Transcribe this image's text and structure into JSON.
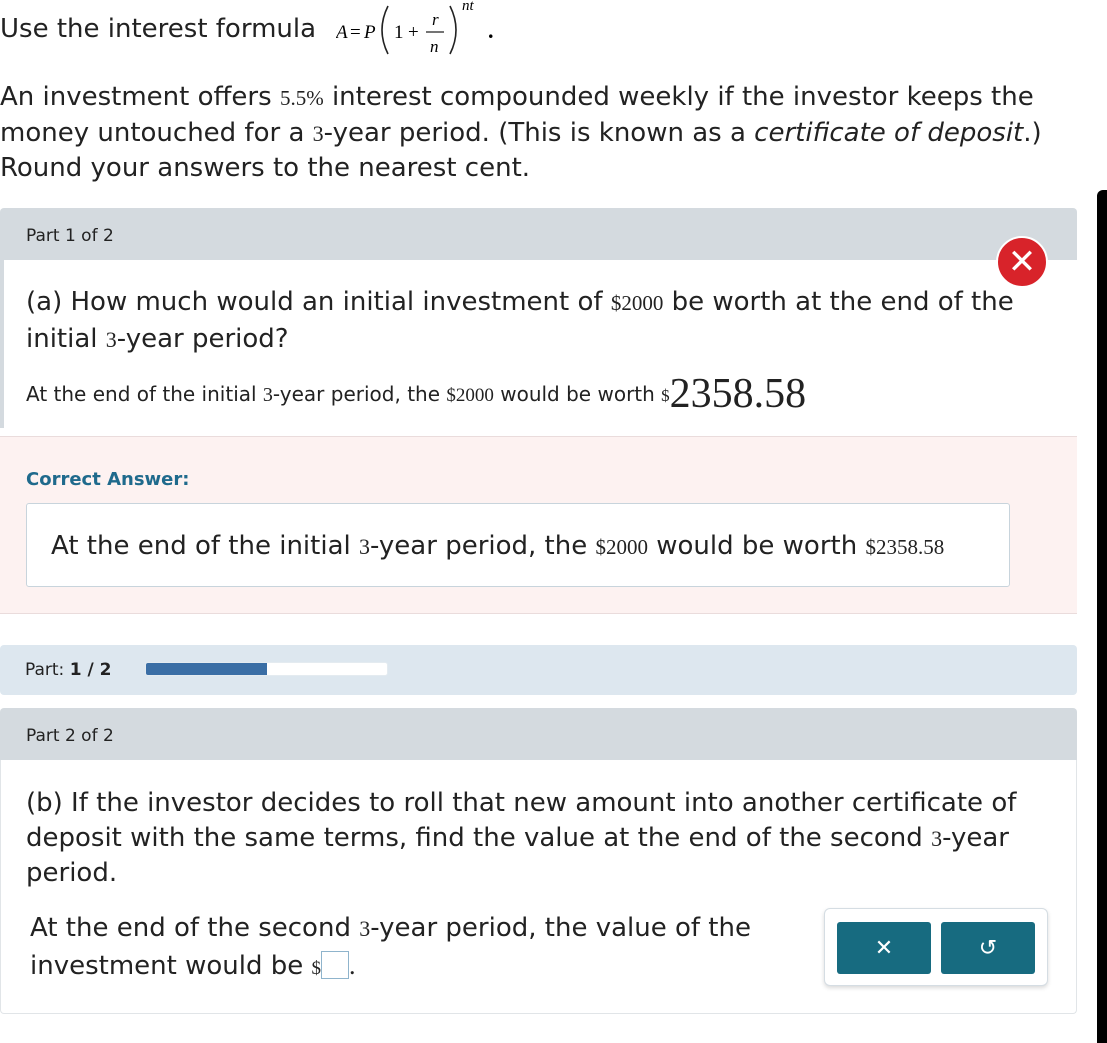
{
  "header": {
    "formula_prefix": "Use the interest formula",
    "formula": {
      "A": "A",
      "eq": "=",
      "P": "P",
      "one": "1",
      "plus": "+",
      "r": "r",
      "n": "n",
      "exp": "nt",
      "period": "."
    }
  },
  "intro": {
    "part1": "An investment offers ",
    "rate": "5.5%",
    "part2": " interest compounded weekly if the investor keeps the money untouched for a ",
    "years": "3",
    "part3": "-year period. (This is known as a ",
    "emphasis": "certificate of deposit",
    "part4": ".) Round your answers to the nearest cent."
  },
  "part1": {
    "header": "Part 1 of 2",
    "status_icon": "close-x-icon",
    "question": {
      "a": "(a) How much would an initial investment of ",
      "amount": "$2000",
      "b": " be worth at the end of the initial ",
      "years": "3",
      "c": "-year period?"
    },
    "answer": {
      "a": "At the end of the initial ",
      "years": "3",
      "b": "-year period, the ",
      "amount": "$2000",
      "c": " would be worth ",
      "currency": "$",
      "value": "2358.58"
    },
    "correct_label": "Correct Answer:",
    "correct": {
      "a": "At the end of the initial ",
      "years": "3",
      "b": "-year period, the ",
      "amount": "$2000",
      "c": " would be worth ",
      "value": "$2358.58"
    }
  },
  "progress": {
    "label": "Part: ",
    "current": "1",
    "sep": " / ",
    "total": "2",
    "fraction": 0.5,
    "color": "#3a6ea5"
  },
  "part2": {
    "header": "Part 2 of 2",
    "question": {
      "a": "(b) If the investor decides to roll that new amount into another certificate of deposit with the same terms, find the value at the end of the second ",
      "years": "3",
      "b": "-year period."
    },
    "answer": {
      "a": "At the end of the second ",
      "years": "3",
      "b": "-year period, the value of the investment would be ",
      "currency": "$",
      "end": "."
    },
    "buttons": {
      "clear": "✕",
      "undo": "↺"
    }
  },
  "colors": {
    "accent": "#176b80",
    "error": "#d8232a",
    "correct_label": "#1f6a8c"
  }
}
